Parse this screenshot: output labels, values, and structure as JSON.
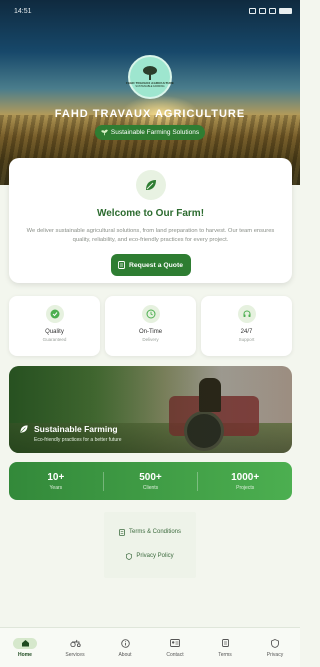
{
  "status_bar": {
    "time": "14:51"
  },
  "hero": {
    "logo_text": "FAHD TRAVAUX AGRICULTURE",
    "logo_subtext": "SUSTAINABLE FARMING",
    "title": "FAHD TRAVAUX AGRICULTURE",
    "tagline": "Sustainable Farming Solutions"
  },
  "welcome": {
    "title": "Welcome to Our Farm!",
    "description": "We deliver sustainable agricultural solutions, from land preparation to harvest. Our team ensures quality, reliability, and eco-friendly practices for every project.",
    "button_label": "Request a Quote"
  },
  "features": [
    {
      "icon": "check-badge-icon",
      "title": "Quality",
      "subtitle": "Guaranteed"
    },
    {
      "icon": "clock-icon",
      "title": "On-Time",
      "subtitle": "Delivery"
    },
    {
      "icon": "support-icon",
      "title": "24/7",
      "subtitle": "Support"
    }
  ],
  "banner": {
    "title": "Sustainable Farming",
    "subtitle": "Eco-friendly practices for a better future"
  },
  "stats": [
    {
      "number": "10+",
      "label": "Years"
    },
    {
      "number": "500+",
      "label": "Clients"
    },
    {
      "number": "1000+",
      "label": "Projects"
    }
  ],
  "links": {
    "terms": "Terms & Conditions",
    "privacy": "Privacy Policy"
  },
  "nav": [
    {
      "label": "Home",
      "icon": "home-icon",
      "active": true
    },
    {
      "label": "Services",
      "icon": "tractor-icon",
      "active": false
    },
    {
      "label": "About",
      "icon": "info-icon",
      "active": false
    },
    {
      "label": "Contact",
      "icon": "contact-icon",
      "active": false
    },
    {
      "label": "Terms",
      "icon": "document-icon",
      "active": false
    },
    {
      "label": "Privacy",
      "icon": "shield-icon",
      "active": false
    }
  ],
  "colors": {
    "primary": "#2e7d32",
    "accent": "#4caf50",
    "background": "#f3f6ee"
  }
}
